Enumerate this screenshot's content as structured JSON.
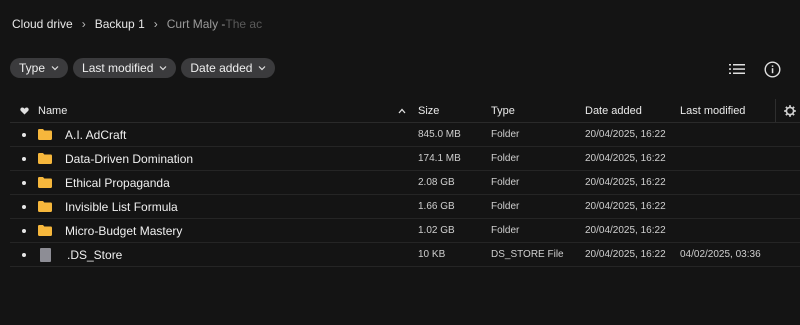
{
  "breadcrumb": {
    "items": [
      "Cloud drive",
      "Backup 1",
      "Curt Maly - "
    ],
    "tail": "The ac"
  },
  "filters": [
    {
      "label": "Type"
    },
    {
      "label": "Last modified"
    },
    {
      "label": "Date added"
    }
  ],
  "icons": {
    "list_view": "list-view-icon",
    "info": "info-icon",
    "settings": "gear-icon",
    "favorite": "heart-icon",
    "sort": "sort-asc-icon",
    "folder": "folder-icon",
    "file": "file-icon"
  },
  "colors": {
    "background": "#141414",
    "chip": "#3b3b3d",
    "folder": "#f6b73c",
    "file": "#8d8d95"
  },
  "table": {
    "headers": {
      "name": "Name",
      "size": "Size",
      "type": "Type",
      "added": "Date added",
      "modified": "Last modified"
    },
    "rows": [
      {
        "name": "A.I. AdCraft",
        "size": "845.0 MB",
        "type": "Folder",
        "added": "20/04/2025, 16:22",
        "modified": "",
        "kind": "folder"
      },
      {
        "name": "Data-Driven Domination",
        "size": "174.1 MB",
        "type": "Folder",
        "added": "20/04/2025, 16:22",
        "modified": "",
        "kind": "folder"
      },
      {
        "name": "Ethical Propaganda",
        "size": "2.08 GB",
        "type": "Folder",
        "added": "20/04/2025, 16:22",
        "modified": "",
        "kind": "folder"
      },
      {
        "name": "Invisible List Formula",
        "size": "1.66 GB",
        "type": "Folder",
        "added": "20/04/2025, 16:22",
        "modified": "",
        "kind": "folder"
      },
      {
        "name": "Micro-Budget Mastery",
        "size": "1.02 GB",
        "type": "Folder",
        "added": "20/04/2025, 16:22",
        "modified": "",
        "kind": "folder"
      },
      {
        "name": ".DS_Store",
        "size": "10 KB",
        "type": "DS_STORE File",
        "added": "20/04/2025, 16:22",
        "modified": "04/02/2025, 03:36",
        "kind": "file"
      }
    ]
  }
}
